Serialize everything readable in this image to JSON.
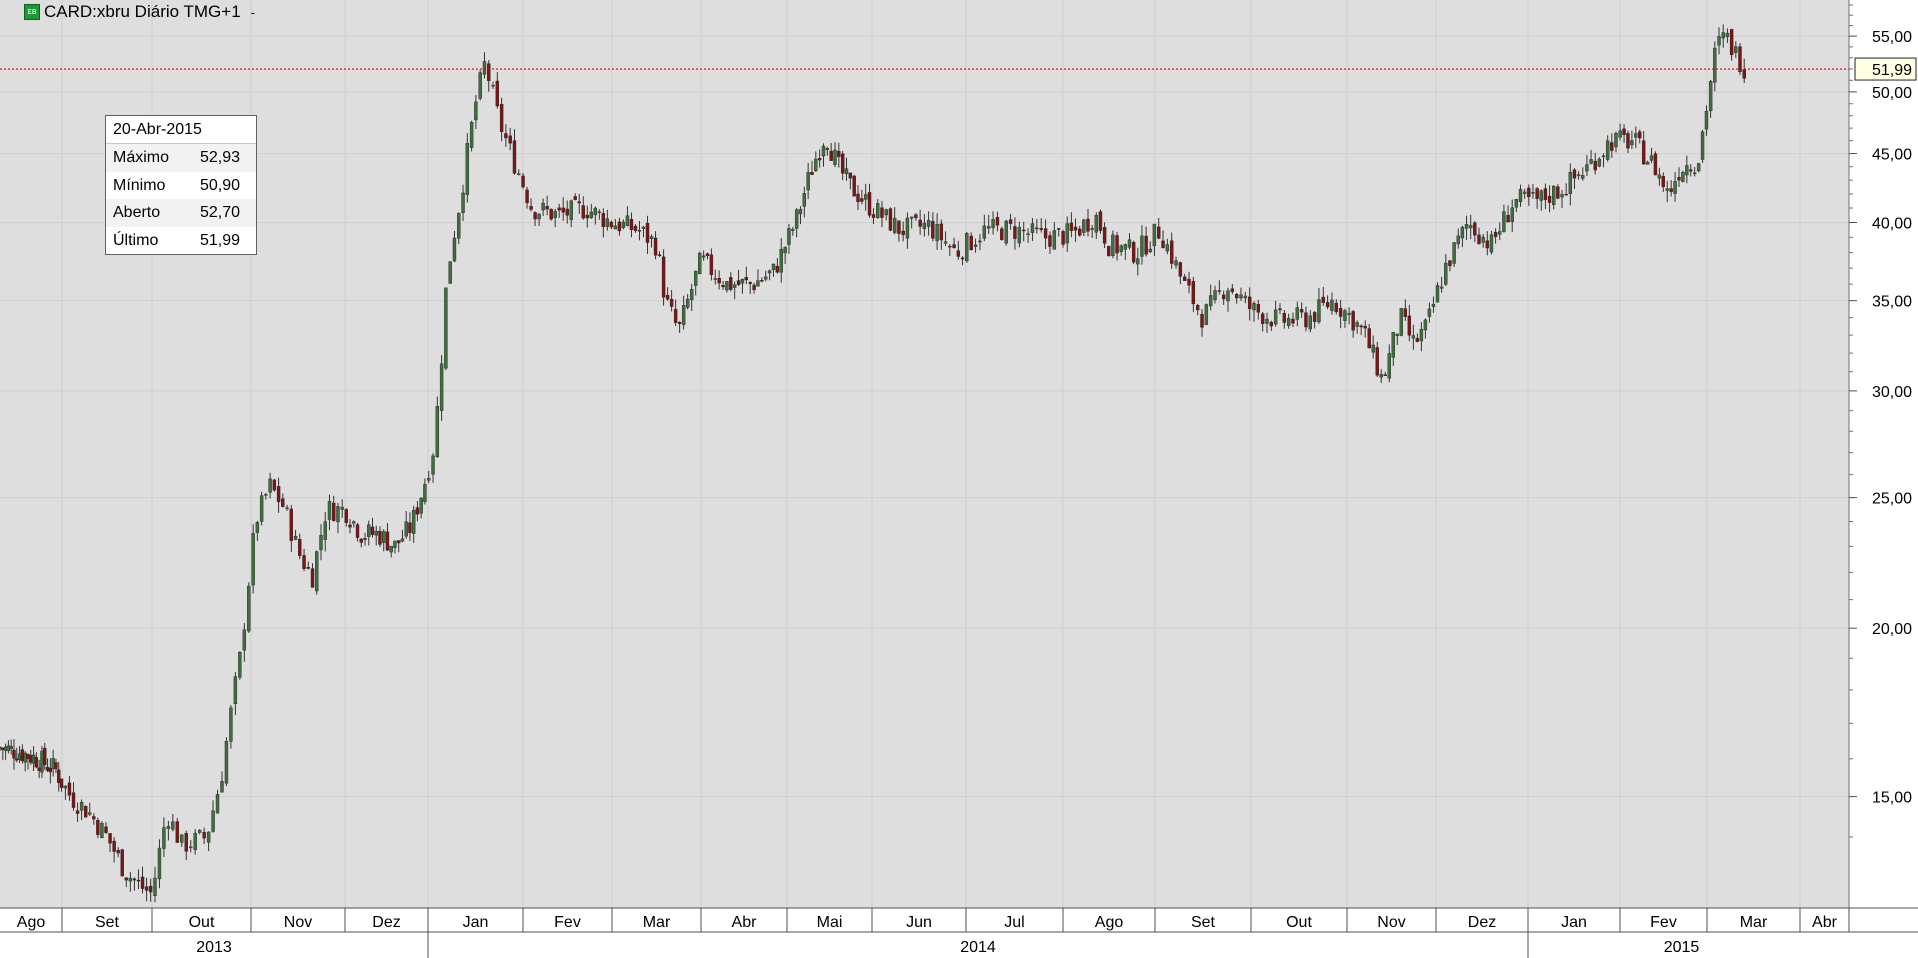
{
  "header": {
    "title": "CARD:xbru Diário TMG+1",
    "icon": "green-exchange-icon",
    "dropdown_icon": "dropdown-arrow-icon"
  },
  "info_box": {
    "date": "20-Abr-2015",
    "rows": [
      {
        "label": "Máximo",
        "value": "52,93"
      },
      {
        "label": "Mínimo",
        "value": "50,90"
      },
      {
        "label": "Aberto",
        "value": "52,70"
      },
      {
        "label": "Último",
        "value": "51,99"
      }
    ]
  },
  "last_price_label": "51,99",
  "colors": {
    "background": "#dedede",
    "up_candle": "#3f6f3f",
    "down_candle": "#7a1616",
    "last_price_line": "#e00000"
  },
  "chart_data": {
    "type": "candlestick",
    "y_scale": "log",
    "ylim": [
      12.4,
      58.5
    ],
    "y_ticks": [
      {
        "value": 15,
        "label": "15,00"
      },
      {
        "value": 20,
        "label": "20,00"
      },
      {
        "value": 25,
        "label": "25,00"
      },
      {
        "value": 30,
        "label": "30,00"
      },
      {
        "value": 35,
        "label": "35,00"
      },
      {
        "value": 40,
        "label": "40,00"
      },
      {
        "value": 45,
        "label": "45,00"
      },
      {
        "value": 50,
        "label": "50,00"
      },
      {
        "value": 55,
        "label": "55,00"
      }
    ],
    "last_price": 51.99,
    "months": [
      {
        "label": "Ago",
        "month": 0
      },
      {
        "label": "Set",
        "month": 1
      },
      {
        "label": "Out",
        "month": 2
      },
      {
        "label": "Nov",
        "month": 3
      },
      {
        "label": "Dez",
        "month": 4
      },
      {
        "label": "Jan",
        "month": 5
      },
      {
        "label": "Fev",
        "month": 6
      },
      {
        "label": "Mar",
        "month": 7
      },
      {
        "label": "Abr",
        "month": 8
      },
      {
        "label": "Mai",
        "month": 9
      },
      {
        "label": "Jun",
        "month": 10
      },
      {
        "label": "Jul",
        "month": 11
      },
      {
        "label": "Ago",
        "month": 12
      },
      {
        "label": "Set",
        "month": 13
      },
      {
        "label": "Out",
        "month": 14
      },
      {
        "label": "Nov",
        "month": 15
      },
      {
        "label": "Dez",
        "month": 16
      },
      {
        "label": "Jan",
        "month": 17
      },
      {
        "label": "Fev",
        "month": 18
      },
      {
        "label": "Mar",
        "month": 19
      },
      {
        "label": "Abr",
        "month": 20
      }
    ],
    "years": [
      {
        "label": "2013",
        "start_month": 0,
        "end_month": 5
      },
      {
        "label": "2014",
        "start_month": 5,
        "end_month": 17
      },
      {
        "label": "2015",
        "start_month": 17,
        "end_month": 20.7
      }
    ],
    "price_path": [
      [
        0.0,
        16.3
      ],
      [
        0.3,
        16.2
      ],
      [
        0.6,
        16.0
      ],
      [
        0.9,
        15.7
      ],
      [
        1.1,
        15.0
      ],
      [
        1.3,
        14.6
      ],
      [
        1.5,
        14.0
      ],
      [
        1.7,
        13.2
      ],
      [
        1.85,
        12.9
      ],
      [
        2.0,
        12.7
      ],
      [
        2.15,
        14.6
      ],
      [
        2.3,
        13.8
      ],
      [
        2.55,
        14.0
      ],
      [
        2.7,
        15.5
      ],
      [
        2.9,
        19.2
      ],
      [
        3.05,
        24.0
      ],
      [
        3.2,
        25.5
      ],
      [
        3.35,
        24.6
      ],
      [
        3.5,
        22.8
      ],
      [
        3.65,
        21.8
      ],
      [
        3.8,
        24.5
      ],
      [
        4.0,
        24.5
      ],
      [
        4.2,
        23.5
      ],
      [
        4.4,
        23.5
      ],
      [
        4.6,
        23.0
      ],
      [
        4.8,
        23.8
      ],
      [
        4.95,
        25.5
      ],
      [
        5.05,
        27.0
      ],
      [
        5.12,
        30.0
      ],
      [
        5.2,
        36.5
      ],
      [
        5.35,
        42.0
      ],
      [
        5.5,
        49.0
      ],
      [
        5.6,
        52.5
      ],
      [
        5.75,
        47.5
      ],
      [
        5.9,
        44.5
      ],
      [
        6.1,
        41.0
      ],
      [
        6.4,
        40.5
      ],
      [
        6.7,
        41.0
      ],
      [
        7.0,
        40.0
      ],
      [
        7.3,
        39.5
      ],
      [
        7.5,
        38.5
      ],
      [
        7.6,
        35.0
      ],
      [
        7.75,
        33.2
      ],
      [
        8.0,
        37.5
      ],
      [
        8.3,
        36.0
      ],
      [
        8.6,
        36.0
      ],
      [
        8.85,
        36.8
      ],
      [
        9.1,
        40.0
      ],
      [
        9.3,
        44.0
      ],
      [
        9.45,
        46.5
      ],
      [
        9.6,
        44.0
      ],
      [
        9.75,
        42.5
      ],
      [
        10.0,
        41.0
      ],
      [
        10.3,
        39.5
      ],
      [
        10.6,
        39.8
      ],
      [
        10.9,
        38.0
      ],
      [
        11.2,
        39.5
      ],
      [
        11.5,
        39.5
      ],
      [
        11.8,
        39.0
      ],
      [
        12.1,
        39.2
      ],
      [
        12.35,
        40.5
      ],
      [
        12.5,
        38.5
      ],
      [
        12.8,
        38.0
      ],
      [
        13.05,
        39.5
      ],
      [
        13.3,
        36.0
      ],
      [
        13.5,
        34.0
      ],
      [
        13.75,
        36.0
      ],
      [
        14.0,
        34.5
      ],
      [
        14.3,
        33.8
      ],
      [
        14.6,
        34.0
      ],
      [
        14.85,
        35.0
      ],
      [
        15.05,
        34.0
      ],
      [
        15.2,
        33.0
      ],
      [
        15.4,
        30.5
      ],
      [
        15.6,
        34.0
      ],
      [
        15.75,
        32.5
      ],
      [
        15.9,
        33.5
      ],
      [
        16.1,
        37.0
      ],
      [
        16.35,
        40.0
      ],
      [
        16.6,
        38.5
      ],
      [
        16.85,
        41.5
      ],
      [
        17.1,
        41.5
      ],
      [
        17.4,
        42.5
      ],
      [
        17.65,
        44.0
      ],
      [
        17.9,
        46.0
      ],
      [
        18.15,
        46.0
      ],
      [
        18.4,
        44.0
      ],
      [
        18.55,
        42.0
      ],
      [
        18.7,
        44.0
      ],
      [
        18.9,
        44.5
      ],
      [
        19.0,
        49.0
      ],
      [
        19.1,
        54.0
      ],
      [
        19.2,
        55.0
      ],
      [
        19.3,
        53.5
      ],
      [
        19.4,
        52.2
      ]
    ]
  }
}
